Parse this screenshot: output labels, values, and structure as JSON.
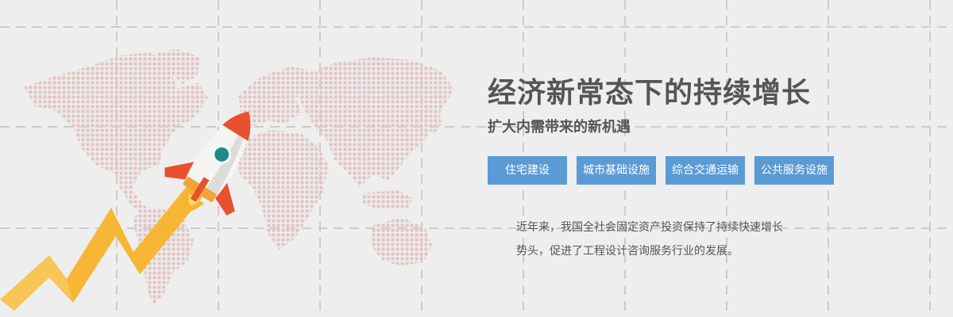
{
  "banner": {
    "headline": "经济新常态下的持续增长",
    "subheadline": "扩大内需带来的新机遇",
    "tags": [
      {
        "label": "住宅建设"
      },
      {
        "label": "城市基础设施"
      },
      {
        "label": "综合交通运输"
      },
      {
        "label": "公共服务设施"
      }
    ],
    "description_lines": [
      "近年来，我国全社会固定资产投资保持了持续快速增长",
      "势头，促进了工程设计咨询服务行业的发展。"
    ]
  },
  "colors": {
    "background": "#eeeeee",
    "grid_line": "#cccccc",
    "map_dot": "#e6c9c9",
    "tag_background": "#5b9bd5",
    "tag_text": "#ffffff",
    "text": "#555555",
    "rocket_red": "#e8502e",
    "rocket_body": "#f4f4f2",
    "rocket_window": "#1f8a8a",
    "trail_orange": "#f7b32b"
  },
  "icons": [
    "rocket-icon",
    "world-map-graphic",
    "growth-arrow-graphic"
  ]
}
